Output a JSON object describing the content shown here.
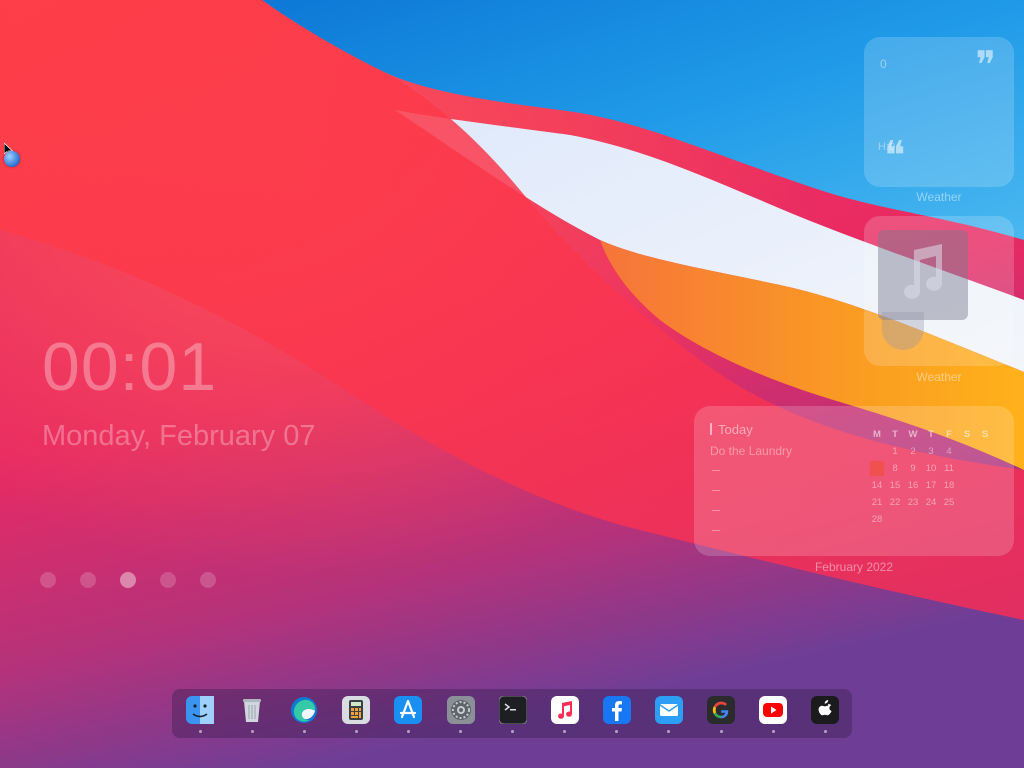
{
  "desktop": {
    "clock_time": "00:01",
    "clock_date": "Monday, February 07",
    "page_dots": [
      false,
      false,
      true,
      false,
      false
    ]
  },
  "widgets": {
    "weather": {
      "small_text": "0",
      "hl_text": "H:0",
      "label": "Weather"
    },
    "music": {
      "label": "Weather"
    },
    "calendar": {
      "today_label": "Today",
      "task": "Do the Laundry",
      "weekdays": [
        "M",
        "T",
        "W",
        "T",
        "F",
        "S",
        "S"
      ],
      "weeks": [
        [
          "",
          "1",
          "2",
          "3",
          "4",
          "",
          ""
        ],
        [
          "7",
          "8",
          "9",
          "10",
          "11",
          "",
          ""
        ],
        [
          "14",
          "15",
          "16",
          "17",
          "18",
          "",
          ""
        ],
        [
          "21",
          "22",
          "23",
          "24",
          "25",
          "",
          ""
        ],
        [
          "28",
          "",
          "",
          "",
          "",
          "",
          ""
        ]
      ],
      "today_day": "7",
      "month_label": "February 2022"
    }
  },
  "dock": {
    "apps": [
      {
        "name": "Finder",
        "icon": "finder-icon"
      },
      {
        "name": "Trash",
        "icon": "trash-icon"
      },
      {
        "name": "Microsoft Edge",
        "icon": "edge-icon"
      },
      {
        "name": "Calculator",
        "icon": "calculator-icon"
      },
      {
        "name": "App Store",
        "icon": "app-store-icon"
      },
      {
        "name": "System Preferences",
        "icon": "settings-icon"
      },
      {
        "name": "Terminal",
        "icon": "terminal-icon"
      },
      {
        "name": "Music",
        "icon": "music-icon"
      },
      {
        "name": "Facebook",
        "icon": "facebook-icon"
      },
      {
        "name": "Mail",
        "icon": "mail-icon"
      },
      {
        "name": "Google",
        "icon": "google-icon"
      },
      {
        "name": "YouTube",
        "icon": "youtube-icon"
      },
      {
        "name": "Apple TV",
        "icon": "apple-tv-icon"
      }
    ]
  },
  "colors": {
    "wallpaper_red": "#ef2c4f",
    "wallpaper_blue": "#1f8fe0",
    "wallpaper_orange": "#f8a21e",
    "wallpaper_purple": "#7b3a96"
  }
}
